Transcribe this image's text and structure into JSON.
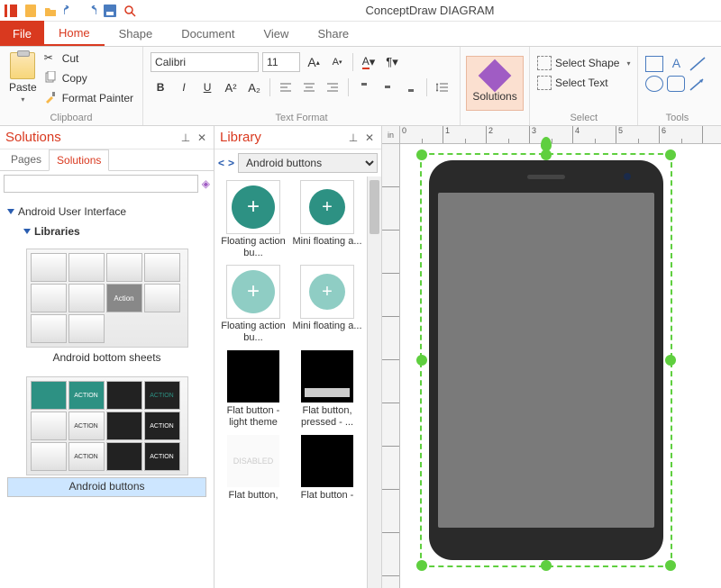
{
  "app_title": "ConceptDraw DIAGRAM",
  "qat_icons": [
    "app-icon",
    "new-doc-icon",
    "open-icon",
    "undo-icon",
    "redo-icon",
    "save-icon",
    "search-icon"
  ],
  "file_tab": "File",
  "tabs": [
    "Home",
    "Shape",
    "Document",
    "View",
    "Share"
  ],
  "active_tab": "Home",
  "ribbon": {
    "clipboard": {
      "label": "Clipboard",
      "paste": "Paste",
      "cut": "Cut",
      "copy": "Copy",
      "format_painter": "Format Painter"
    },
    "text_format": {
      "label": "Text Format",
      "font": "Calibri",
      "size": "11"
    },
    "solutions_btn": "Solutions",
    "select": {
      "label": "Select",
      "select_shape": "Select Shape",
      "select_text": "Select Text"
    },
    "tools_label": "Tools"
  },
  "solutions_panel": {
    "title": "Solutions",
    "subtabs": [
      "Pages",
      "Solutions"
    ],
    "active_subtab": "Solutions",
    "tree_root": "Android User Interface",
    "tree_child": "Libraries",
    "thumb1_label": "Android bottom sheets",
    "thumb2_label": "Android buttons"
  },
  "library_panel": {
    "title": "Library",
    "selector": "Android buttons",
    "items": [
      {
        "shape": "fab-dark",
        "label": "Floating action bu..."
      },
      {
        "shape": "fab-dark",
        "label": "Mini floating a..."
      },
      {
        "shape": "fab-light",
        "label": "Floating action bu..."
      },
      {
        "shape": "fab-light",
        "label": "Mini floating a..."
      },
      {
        "shape": "flat",
        "label": "Flat button - light theme"
      },
      {
        "shape": "flat",
        "label": "Flat button, pressed - ..."
      },
      {
        "shape": "flat",
        "label": "Flat button,"
      },
      {
        "shape": "flat",
        "label": "Flat button -"
      }
    ]
  },
  "ruler_unit": "in",
  "ruler_ticks_h": [
    "0",
    "1",
    "2",
    "3",
    "4",
    "5",
    "6"
  ]
}
